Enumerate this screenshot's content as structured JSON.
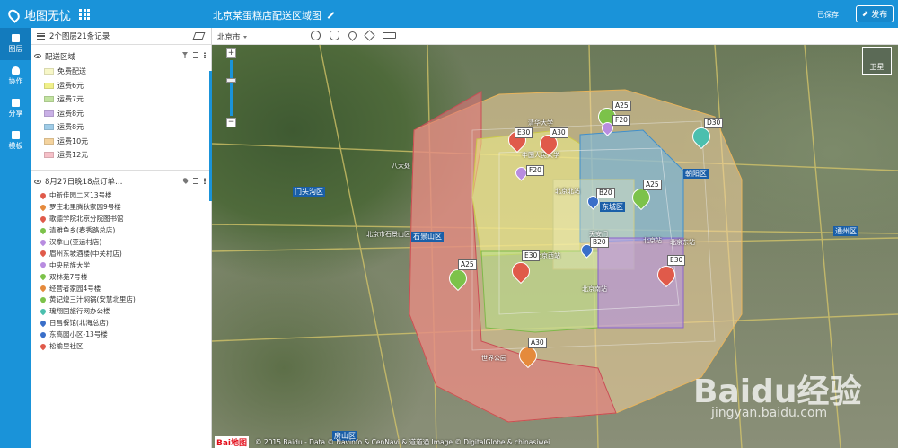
{
  "app": {
    "name": "地图无忧",
    "map_title": "北京某蛋糕店配送区域图",
    "saved_text": "已保存",
    "publish_label": "发布"
  },
  "nav": [
    {
      "label": "图层",
      "icon": "layers-icon"
    },
    {
      "label": "协作",
      "icon": "person-icon"
    },
    {
      "label": "分享",
      "icon": "share-icon"
    },
    {
      "label": "模板",
      "icon": "template-icon"
    }
  ],
  "panel": {
    "summary": "2个图层21条记录",
    "layer1": {
      "title": "配送区域",
      "legend": [
        {
          "label": "免费配送",
          "color": "#f7f7c8"
        },
        {
          "label": "运费6元",
          "color": "#f0f08a"
        },
        {
          "label": "运费7元",
          "color": "#c2e3a0"
        },
        {
          "label": "运费8元",
          "color": "#c9b0e6"
        },
        {
          "label": "运费8元",
          "color": "#9fcce8"
        },
        {
          "label": "运费10元",
          "color": "#f4d39e"
        },
        {
          "label": "运费12元",
          "color": "#f5c0c8"
        }
      ]
    },
    "layer2": {
      "title": "8月27日晚18点订单…",
      "items": [
        {
          "label": "中新佳园二区13号楼",
          "color": "#e05a4a"
        },
        {
          "label": "罗庄北里腾秋家园9号楼",
          "color": "#e58a3c"
        },
        {
          "label": "歌德学院北京分院图书馆",
          "color": "#e05a4a"
        },
        {
          "label": "清雅鱼乡(春秀路总店)",
          "color": "#7cc24a"
        },
        {
          "label": "汉拿山(亚运村店)",
          "color": "#b88ce0"
        },
        {
          "label": "眉州东坡酒楼(中关村店)",
          "color": "#e05a4a"
        },
        {
          "label": "中央民族大学",
          "color": "#b88ce0"
        },
        {
          "label": "双林苑7号楼",
          "color": "#7cc24a"
        },
        {
          "label": "经营者家园4号楼",
          "color": "#e58a3c"
        },
        {
          "label": "黄记煌三汁焖锅(安慧北里店)",
          "color": "#7cc24a"
        },
        {
          "label": "瑰翔国旅行网办公楼",
          "color": "#4bbfae"
        },
        {
          "label": "日昌餐馆(北海总店)",
          "color": "#3a6fc9"
        },
        {
          "label": "东高园小区-13号楼",
          "color": "#3a6fc9"
        },
        {
          "label": "松榆里社区",
          "color": "#e05a4a"
        }
      ]
    }
  },
  "toolbar": {
    "city": "北京市"
  },
  "map": {
    "satellite_label": "卫星",
    "copyright": "© 2015 Baidu - Data © Navinfo & CenNavi & 道道通 Image © DigitalGlobe & chinasiwei",
    "baidu_logo": "Bai地图",
    "watermark": "Baidu经验",
    "watermark_url": "jingyan.baidu.com",
    "districts": [
      "门头沟区",
      "石景山区",
      "东城区",
      "朝阳区",
      "通州区",
      "房山区"
    ],
    "places": [
      "八大处",
      "北京市石景山区",
      "北京站",
      "天安门",
      "北京西站",
      "北京南站",
      "世界公园",
      "清华大学",
      "中国人民大学",
      "北京北站",
      "北京东站"
    ],
    "markers": [
      {
        "label": "A30",
        "color": "#e05a4a"
      },
      {
        "label": "E30",
        "color": "#e05a4a"
      },
      {
        "label": "F20",
        "color": "#b88ce0"
      },
      {
        "label": "A25",
        "color": "#7cc24a"
      },
      {
        "label": "F20",
        "color": "#b88ce0"
      },
      {
        "label": "D30",
        "color": "#4bbfae"
      },
      {
        "label": "A25",
        "color": "#7cc24a"
      },
      {
        "label": "B20",
        "color": "#3a6fc9"
      },
      {
        "label": "B20",
        "color": "#3a6fc9"
      },
      {
        "label": "E30",
        "color": "#e05a4a"
      },
      {
        "label": "E30",
        "color": "#e05a4a"
      },
      {
        "label": "A25",
        "color": "#7cc24a"
      },
      {
        "label": "A30",
        "color": "#e58a3c"
      },
      {
        "label": "A25",
        "color": "#7cc24a"
      }
    ]
  }
}
